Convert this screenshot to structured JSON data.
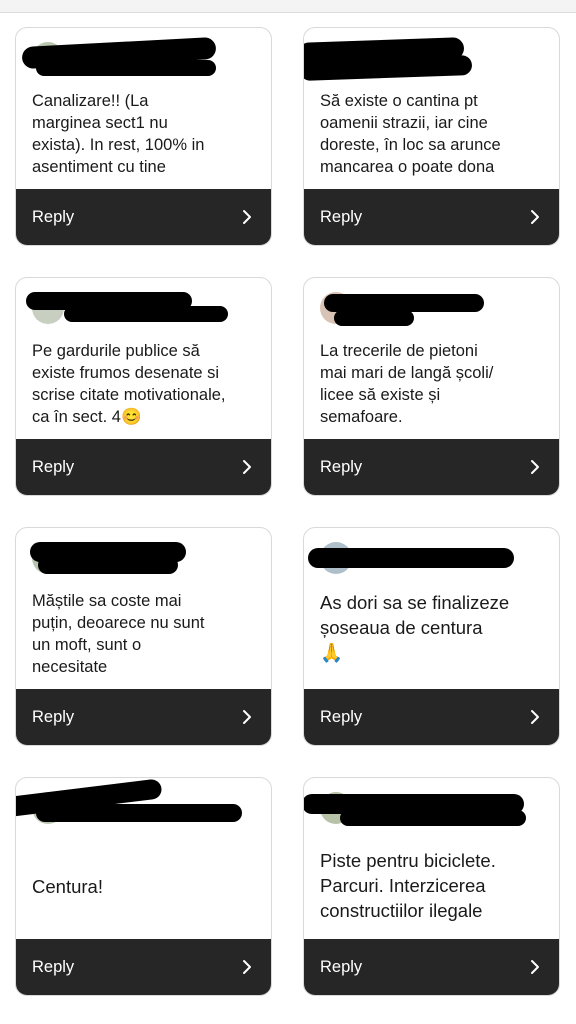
{
  "cards": [
    {
      "message": "Canalizare!! (La\nmarginea sect1 nu\nexista). In rest, 100% in\nasentiment cu tine",
      "reply_label": "Reply"
    },
    {
      "message": "Să existe o cantina pt\noamenii strazii, iar cine\ndoreste, în loc sa arunce\nmancarea o poate dona",
      "reply_label": "Reply"
    },
    {
      "message": "Pe gardurile publice să\nexiste frumos desenate si\nscrise citate motivationale,\nca în sect. 4😊",
      "reply_label": "Reply"
    },
    {
      "message": "La trecerile de pietoni\nmai mari de langă școli/\nlicee să existe și\nsemafoare.",
      "reply_label": "Reply"
    },
    {
      "message": " Măștile sa coste mai\npuțin, deoarece nu sunt\nun moft, sunt o\nnecesitate",
      "reply_label": "Reply"
    },
    {
      "message": "As dori sa se finalizeze\nșoseaua de centura\n🙏",
      "reply_label": "Reply"
    },
    {
      "message": "Centura!",
      "reply_label": "Reply"
    },
    {
      "message": "Piste pentru biciclete.\nParcuri. Interzicerea\nconstructiilor ilegale",
      "reply_label": "Reply"
    }
  ],
  "icons": {
    "reply_chevron": "chevron-right-icon"
  },
  "colors": {
    "reply_bar": "#262626",
    "card_border": "#d9d9d9",
    "text": "#1a1a1a",
    "redaction": "#000000"
  }
}
